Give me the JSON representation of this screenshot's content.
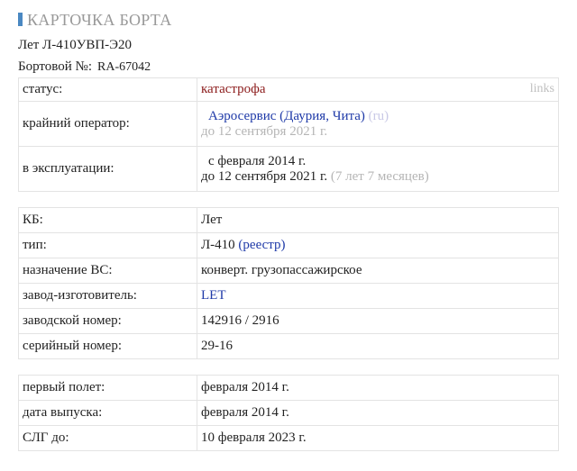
{
  "header": {
    "title": "КАРТОЧКА БОРТА",
    "model_line": "Лет Л-410УВП-Э20",
    "reg_label": "Бортовой №:",
    "reg_value": "RA-67042",
    "accent_color": "#4a88c2"
  },
  "status_block": {
    "status_label": "статус:",
    "status_value": "катастрофа",
    "links_label": "links",
    "operator_label": "крайний оператор:",
    "operator_name": "Аэросервис (Даурия, Чита)",
    "operator_country": "ru",
    "operator_until": "до 12 сентября 2021 г.",
    "service_label": "в эксплуатации:",
    "service_from": "с февраля 2014 г.",
    "service_to": "до 12 сентября 2021 г.",
    "service_duration": "(7 лет 7 месяцев)"
  },
  "specs": [
    {
      "label": "КБ:",
      "value": "Лет"
    },
    {
      "label": "тип:",
      "value": "Л-410",
      "link": "(реестр)"
    },
    {
      "label": "назначение ВС:",
      "value": "конверт. грузопассажирское"
    },
    {
      "label": "завод-изготовитель:",
      "value": "LET"
    },
    {
      "label": "заводской номер:",
      "value": "142916 / 2916"
    },
    {
      "label": "серийный номер:",
      "value": "29-16"
    }
  ],
  "dates": [
    {
      "label": "первый полет:",
      "value": "февраля 2014 г."
    },
    {
      "label": "дата выпуска:",
      "value": "февраля 2014 г."
    },
    {
      "label": "СЛГ до:",
      "value": "10 февраля 2023 г."
    }
  ]
}
